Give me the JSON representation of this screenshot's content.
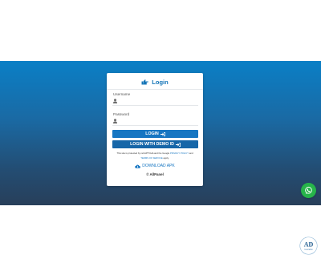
{
  "login_card": {
    "title": "Login",
    "username": {
      "label": "Username",
      "value": ""
    },
    "password": {
      "label": "Password",
      "value": ""
    },
    "login_button": "LOGIN",
    "demo_button": "LOGIN WITH DEMO ID",
    "captcha_notice": {
      "text1": "This site is protected by reCAPTCHA and the Google",
      "privacy_link": "PRIVACY POLICY",
      "text2": "and",
      "terms_link": "TERMS OF SERVICE",
      "text3": "apply."
    },
    "download_label": "DOWNLOAD APK",
    "copyright": "© AllPanel"
  },
  "brand_logo": {
    "initials": "AD",
    "tagline": "Guardian"
  },
  "colors": {
    "accent": "#1676c2",
    "whatsapp": "#27b44a",
    "hero_top": "#0a7fc6",
    "hero_bottom": "#283f5a"
  },
  "icons": {
    "title": "hand-point-right-icon",
    "user": "user-icon",
    "login": "sign-in-icon",
    "download": "cloud-download-icon",
    "chat": "whatsapp-icon"
  }
}
